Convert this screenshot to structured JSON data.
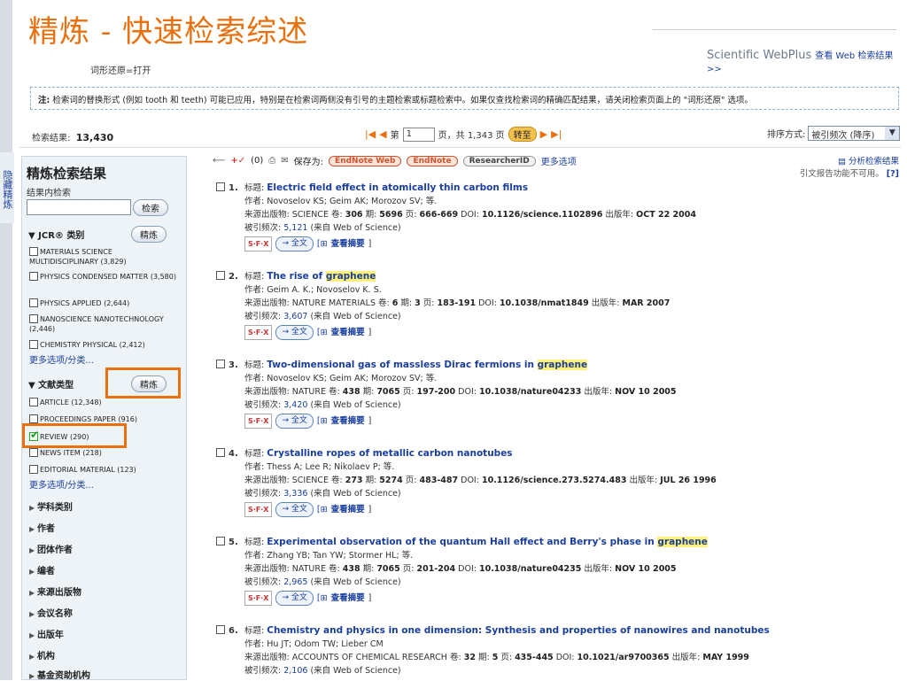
{
  "header": {
    "title": "精炼 - 快速检索综述",
    "stem_note": "词形还原=打开",
    "webplus_brand": "Scientific WebPlus",
    "webplus_link": "查看 Web 检索结果 >>"
  },
  "notice": {
    "prefix": "注:",
    "text": " 检索词的替换形式 (例如 tooth 和 teeth) 可能已应用，特别是在检索词两侧没有引号的主题检索或标题检索中。如果仅查找检索词的精确匹配结果，请关闭检索页面上的 \"词形还原\" 选项。"
  },
  "results_bar": {
    "label": "检索结果:",
    "count": "13,430",
    "page_prefix": "第",
    "page_value": "1",
    "page_suffix": "页，共 1,343 页",
    "go": "转至",
    "sort_label": "排序方式:",
    "sort_value": "被引频次 (降序)"
  },
  "side_tab": "隐藏精炼",
  "panel": {
    "title": "精炼检索结果",
    "within_label": "结果内检索",
    "search_btn": "检索",
    "jcr": {
      "label": "JCR® 类别",
      "btn": "精炼",
      "items": [
        "MATERIALS SCIENCE MULTIDISCIPLINARY (3,829)",
        "PHYSICS CONDENSED MATTER (3,580)",
        "PHYSICS APPLIED (2,644)",
        "NANOSCIENCE NANOTECHNOLOGY (2,446)",
        "CHEMISTRY PHYSICAL (2,412)"
      ],
      "more": "更多选项/分类..."
    },
    "doctype": {
      "label": "文献类型",
      "btn": "精炼",
      "items": [
        "ARTICLE (12,348)",
        "PROCEEDINGS PAPER (916)",
        "REVIEW (290)",
        "NEWS ITEM (218)",
        "EDITORIAL MATERIAL (123)"
      ],
      "more": "更多选项/分类..."
    },
    "nav": [
      "学科类别",
      "作者",
      "团体作者",
      "编者",
      "来源出版物",
      "会议名称",
      "出版年",
      "机构",
      "基金资助机构"
    ]
  },
  "toolbar": {
    "marked": "(0)",
    "save_as": "保存为:",
    "endnote_web": "EndNote Web",
    "endnote": "EndNote",
    "researcherid": "ResearcherID",
    "more": "更多选项"
  },
  "analyze": {
    "link": "分析检索结果",
    "note": "引文报告功能不可用。",
    "help": "[?]"
  },
  "results": [
    {
      "n": "1.",
      "title_pre": "Electric field effect in atomically thin carbon films",
      "hl": "",
      "title_post": "",
      "authors": "作者: Novoselov KS; Geim AK; Morozov SV; 等.",
      "source": "SCIENCE",
      "vol": "306",
      "issue": "5696",
      "pages": "666-669",
      "doi": "10.1126/science.1102896",
      "date": "OCT 22 2004",
      "cites": "5,121"
    },
    {
      "n": "2.",
      "title_pre": "The rise of ",
      "hl": "graphene",
      "title_post": "",
      "authors": "作者: Geim A. K.; Novoselov K. S.",
      "source": "NATURE MATERIALS",
      "vol": "6",
      "issue": "3",
      "pages": "183-191",
      "doi": "10.1038/nmat1849",
      "date": "MAR 2007",
      "cites": "3,607"
    },
    {
      "n": "3.",
      "title_pre": "Two-dimensional gas of massless Dirac fermions in ",
      "hl": "graphene",
      "title_post": "",
      "authors": "作者: Novoselov KS; Geim AK; Morozov SV; 等.",
      "source": "NATURE",
      "vol": "438",
      "issue": "7065",
      "pages": "197-200",
      "doi": "10.1038/nature04233",
      "date": "NOV 10 2005",
      "cites": "3,420"
    },
    {
      "n": "4.",
      "title_pre": "Crystalline ropes of metallic carbon nanotubes",
      "hl": "",
      "title_post": "",
      "authors": "作者: Thess A; Lee R; Nikolaev P; 等.",
      "source": "SCIENCE",
      "vol": "273",
      "issue": "5274",
      "pages": "483-487",
      "doi": "10.1126/science.273.5274.483",
      "date": "JUL 26 1996",
      "cites": "3,336"
    },
    {
      "n": "5.",
      "title_pre": "Experimental observation of the quantum Hall effect and Berry's phase in ",
      "hl": "graphene",
      "title_post": "",
      "authors": "作者: Zhang YB; Tan YW; Stormer HL; 等.",
      "source": "NATURE",
      "vol": "438",
      "issue": "7065",
      "pages": "201-204",
      "doi": "10.1038/nature04235",
      "date": "NOV 10 2005",
      "cites": "2,965"
    },
    {
      "n": "6.",
      "title_pre": "Chemistry and physics in one dimension: Synthesis and properties of nanowires and nanotubes",
      "hl": "",
      "title_post": "",
      "authors": "作者: Hu JT; Odom TW; Lieber CM",
      "source": "ACCOUNTS OF CHEMICAL RESEARCH",
      "vol": "32",
      "issue": "5",
      "pages": "435-445",
      "doi": "10.1021/ar9700365",
      "date": "MAY 1999",
      "cites": "2,106"
    }
  ],
  "labels": {
    "title": "标题: ",
    "source": "来源出版物: ",
    "vol": " 卷: ",
    "issue": " 期: ",
    "pages": " 页: ",
    "doi": " DOI: ",
    "date": " 出版年: ",
    "cited": "被引频次: ",
    "from": " (来自 Web of Science)",
    "sfx": "S·F·X",
    "fulltext": "→ 全文",
    "abstract": "查看摘要"
  }
}
